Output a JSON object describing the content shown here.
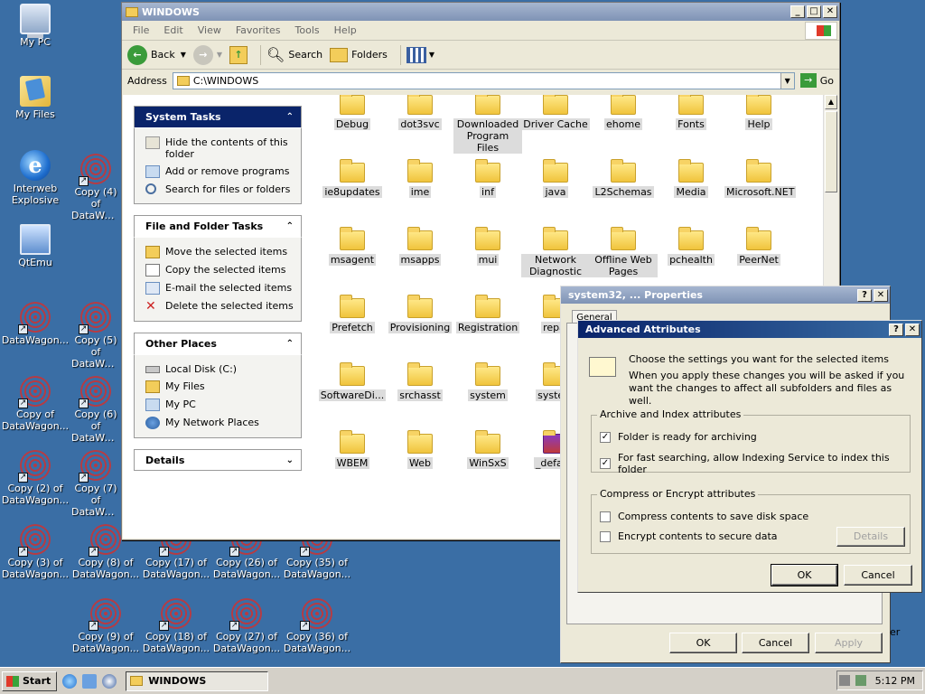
{
  "desktop_icons": [
    {
      "name": "my-pc",
      "label": "My PC",
      "type": "pc"
    },
    {
      "name": "my-files",
      "label": "My Files",
      "type": "docs"
    },
    {
      "name": "interweb",
      "label": "Interweb Explosive",
      "type": "ie"
    },
    {
      "name": "qtemu",
      "label": "QtEmu",
      "type": "qt"
    }
  ],
  "datawagon_icons": [
    {
      "label": "Copy (4) of DataWagon"
    },
    {
      "label": "DataWagon..."
    },
    {
      "label": "Copy (5) of DataWagon"
    },
    {
      "label": "Copy of DataWagon..."
    },
    {
      "label": "Copy (6) of DataWagon"
    },
    {
      "label": "Copy (2) of DataWagon..."
    },
    {
      "label": "Copy (7) of DataWagon"
    },
    {
      "label": "Copy (3) of DataWagon..."
    },
    {
      "label": "Copy (8) of DataWagon..."
    },
    {
      "label": "Copy (17) of DataWagon..."
    },
    {
      "label": "Copy (26) of DataWagon..."
    },
    {
      "label": "Copy (35) of DataWagon..."
    },
    {
      "label": "Copy (9) of DataWagon..."
    },
    {
      "label": "Copy (18) of DataWagon..."
    },
    {
      "label": "Copy (27) of DataWagon..."
    },
    {
      "label": "Copy (36) of DataWagon..."
    }
  ],
  "explorer": {
    "title": "WINDOWS",
    "menu": [
      "File",
      "Edit",
      "View",
      "Favorites",
      "Tools",
      "Help"
    ],
    "toolbar": {
      "back": "Back",
      "search": "Search",
      "folders": "Folders"
    },
    "address_label": "Address",
    "address_value": "C:\\WINDOWS",
    "go_label": "Go",
    "system_tasks": {
      "title": "System Tasks",
      "items": [
        "Hide the contents of this folder",
        "Add or remove programs",
        "Search for files or folders"
      ]
    },
    "file_tasks": {
      "title": "File and Folder Tasks",
      "items": [
        "Move the selected items",
        "Copy the selected items",
        "E-mail the selected items",
        "Delete the selected items"
      ]
    },
    "other_places": {
      "title": "Other Places",
      "items": [
        "Local Disk (C:)",
        "My Files",
        "My PC",
        "My Network Places"
      ]
    },
    "details_title": "Details",
    "folders": [
      "Debug",
      "dot3svc",
      "Downloaded Program Files",
      "Driver Cache",
      "ehome",
      "Fonts",
      "Help",
      "ie8updates",
      "ime",
      "inf",
      "java",
      "L2Schemas",
      "Media",
      "Microsoft.NET",
      "msagent",
      "msapps",
      "mui",
      "Network Diagnostic",
      "Offline Web Pages",
      "pchealth",
      "PeerNet",
      "Prefetch",
      "Provisioning",
      "Registration",
      "repai",
      "SoftwareDi...",
      "srchasst",
      "system",
      "system",
      "WBEM",
      "Web",
      "WinSxS",
      "_default"
    ]
  },
  "properties": {
    "title": "system32, ... Properties",
    "tab": "General",
    "ok": "OK",
    "cancel": "Cancel",
    "apply": "Apply",
    "side_text": "er"
  },
  "advanced": {
    "title": "Advanced Attributes",
    "intro1": "Choose the settings you want for the selected items",
    "intro2": "When you apply these changes you will be asked if you want the changes to affect all subfolders and files as well.",
    "group1": "Archive and Index attributes",
    "chk1": "Folder is ready for archiving",
    "chk2": "For fast searching, allow Indexing Service to index this folder",
    "group2": "Compress or Encrypt attributes",
    "chk3": "Compress contents to save disk space",
    "chk4": "Encrypt contents to secure data",
    "details": "Details",
    "ok": "OK",
    "cancel": "Cancel",
    "chk1_checked": true,
    "chk2_checked": true,
    "chk3_checked": false,
    "chk4_checked": false
  },
  "taskbar": {
    "start": "Start",
    "window_button": "WINDOWS",
    "clock": "5:12 PM"
  }
}
